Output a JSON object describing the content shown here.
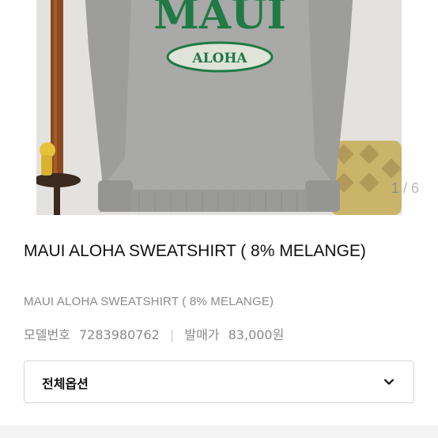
{
  "gallery": {
    "current": "1",
    "separator": "/",
    "total": "6",
    "print_text": "MAUI",
    "patch_text": "ALOHA"
  },
  "product": {
    "title": "MAUI ALOHA SWEATSHIRT ( 8% MELANGE)",
    "subtitle": "MAUI ALOHA SWEATSHIRT ( 8% MELANGE)",
    "model_label": "모델번호",
    "model_number": "7283980762",
    "price_label": "발매가",
    "price": "83,000원"
  },
  "options": {
    "label": "전체옵션"
  },
  "colors": {
    "print_green": "#1f7a45",
    "sweatshirt_gray": "#a9a9a7"
  }
}
